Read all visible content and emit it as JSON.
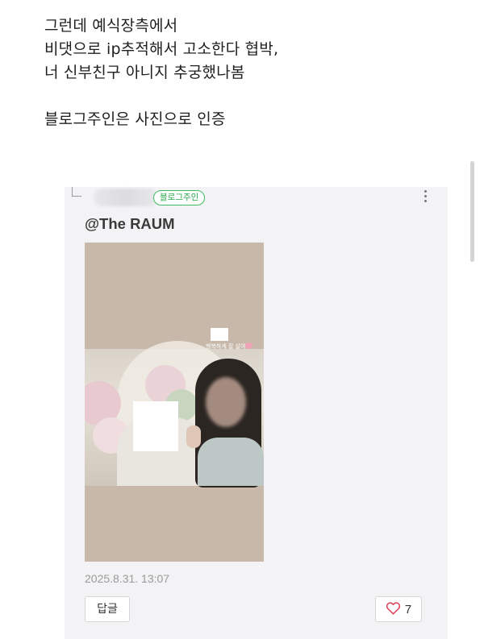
{
  "post": {
    "lines": [
      "그런데 예식장측에서",
      "비댓으로 ip추적해서 고소한다 협박,",
      "너 신부친구 아니지 추궁했나봄",
      "블로그주인은 사진으로 인증"
    ]
  },
  "comment": {
    "badge_label": "블로그주인",
    "mention": "@The RAUM",
    "timestamp": "2025.8.31. 13:07",
    "reply_label": "답글",
    "like_count": "7",
    "photo_caption": "행복하게 잘 살아",
    "icons": {
      "reply": "reply-corner-icon",
      "more": "more-vertical-icon",
      "like": "heart-outline-icon"
    },
    "colors": {
      "badge_green": "#2aa84f",
      "heart_red": "#e0445c",
      "card_bg": "#f3f3f5"
    }
  }
}
